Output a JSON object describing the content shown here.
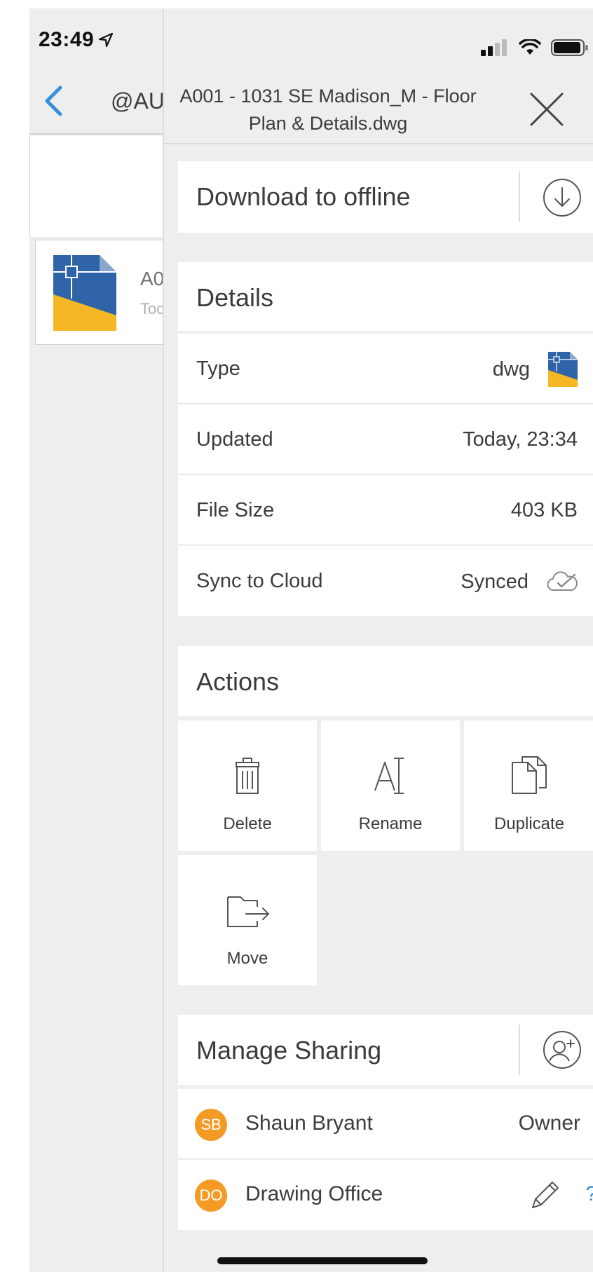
{
  "status_bar": {
    "time": "23:49"
  },
  "background": {
    "header_title": "@AU",
    "file": {
      "name": "A0",
      "subtitle": "Toc"
    }
  },
  "panel": {
    "title": "A001 - 1031 SE Madison_M - Floor Plan & Details.dwg",
    "download": {
      "label": "Download to offline"
    },
    "details": {
      "heading": "Details",
      "rows": [
        {
          "label": "Type",
          "value": "dwg"
        },
        {
          "label": "Updated",
          "value": "Today, 23:34"
        },
        {
          "label": "File Size",
          "value": "403 KB"
        },
        {
          "label": "Sync to Cloud",
          "value": "Synced"
        }
      ]
    },
    "actions": {
      "heading": "Actions",
      "items": [
        {
          "label": "Delete",
          "icon": "trash-icon"
        },
        {
          "label": "Rename",
          "icon": "rename-icon"
        },
        {
          "label": "Duplicate",
          "icon": "duplicate-icon"
        },
        {
          "label": "Move",
          "icon": "move-icon"
        }
      ]
    },
    "sharing": {
      "heading": "Manage Sharing",
      "members": [
        {
          "initials": "SB",
          "name": "Shaun Bryant",
          "role": "Owner"
        },
        {
          "initials": "DO",
          "name": "Drawing Office",
          "role": "?"
        }
      ]
    }
  },
  "colors": {
    "accent_blue": "#3a8fd9",
    "avatar_orange": "#f49b26",
    "dwg_blue": "#2f64a8",
    "dwg_yellow": "#f5b824"
  }
}
